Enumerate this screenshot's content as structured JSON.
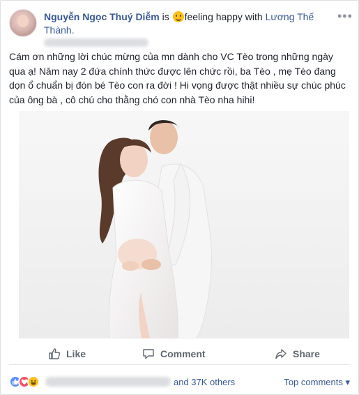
{
  "post": {
    "author": "Nguyễn Ngọc Thuý Diễm",
    "is_word": "is",
    "feeling_text": "feeling happy with",
    "tagged_person": "Lương Thế Thành.",
    "body": "Cám ơn những lời chúc mừng của mn dành cho VC Tèo trong những ngày qua ạ! Năm nay 2 đứa chính thức được lên chức rồi, ba Tèo , mẹ Tèo đang dọn ổ chuẩn bị đón bé Tèo con ra đời ! Hi vọng được thật nhiều sự chúc phúc của ông bà , cô chú cho thằng chó con nhà Tèo nha hihi!",
    "more_glyph": "•••",
    "feeling_icon": "smile-emoji"
  },
  "actions": {
    "like_label": "Like",
    "comment_label": "Comment",
    "share_label": "Share"
  },
  "footer": {
    "others_text": "and 37K others",
    "top_comments_label": "Top comments ▾",
    "reaction_icons": [
      "like-reaction",
      "love-reaction",
      "haha-reaction"
    ]
  },
  "colors": {
    "link_blue": "#365899",
    "action_gray": "#606770",
    "like_blue": "#5890ff",
    "love_red": "#f25268",
    "haha_yellow": "#fcc21b"
  }
}
